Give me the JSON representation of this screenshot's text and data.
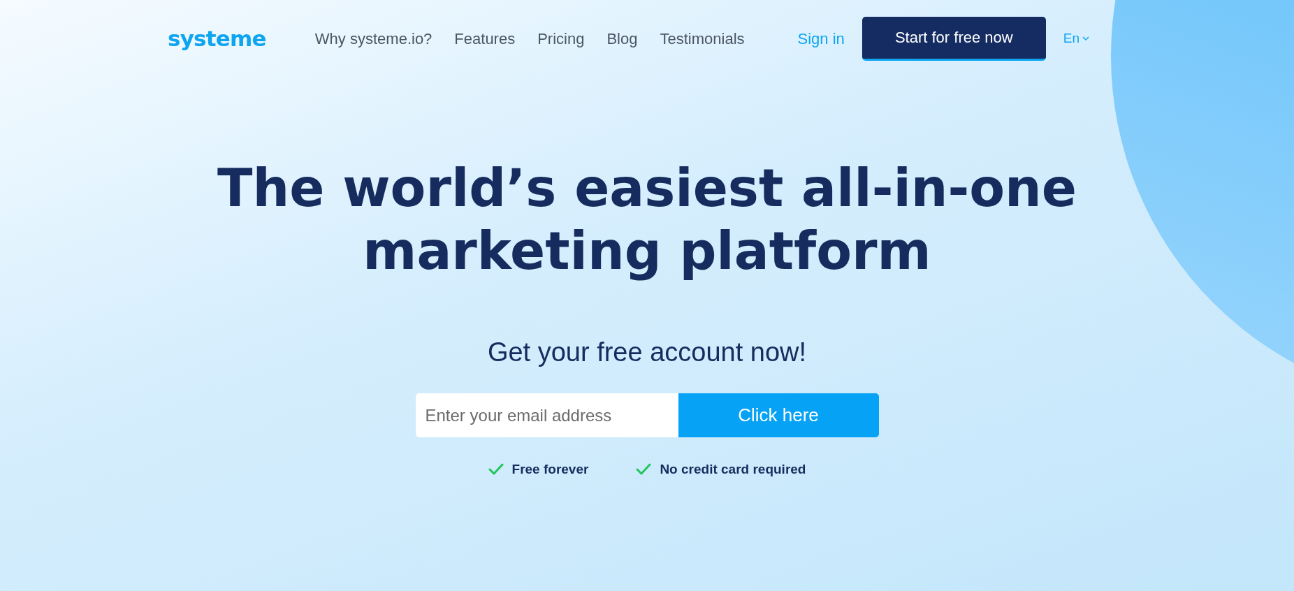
{
  "header": {
    "logo": "systeme",
    "nav": [
      "Why systeme.io?",
      "Features",
      "Pricing",
      "Blog",
      "Testimonials"
    ],
    "sign_in": "Sign in",
    "cta": "Start for free now",
    "language": "En"
  },
  "hero": {
    "headline_lines": [
      "The world’s easiest all-in-one",
      "marketing platform"
    ],
    "subheading": "Get your free account now!",
    "email": {
      "placeholder": "Enter your email address"
    },
    "submit": "Click here",
    "benefits": [
      "Free forever",
      "No credit card required"
    ]
  }
}
